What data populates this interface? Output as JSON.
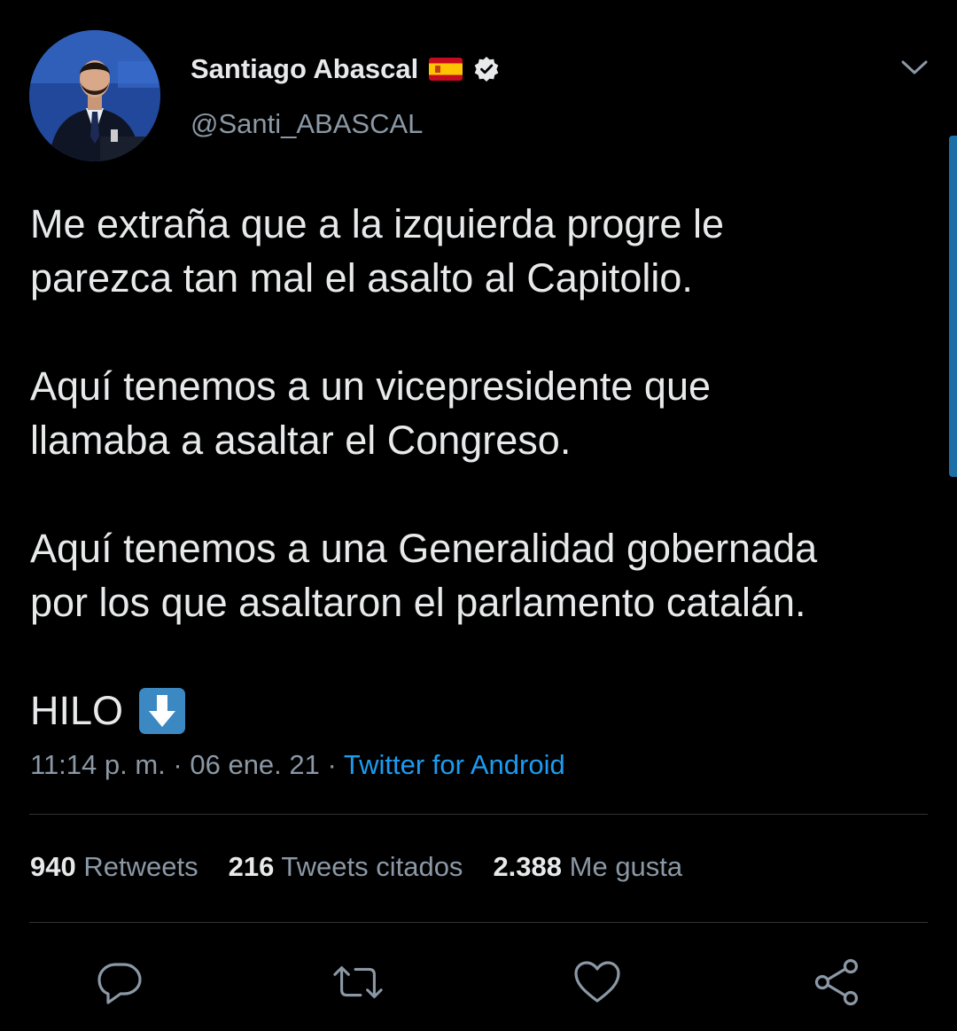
{
  "author": {
    "display_name": "Santiago Abascal",
    "handle": "@Santi_ABASCAL"
  },
  "tweet": {
    "paragraphs": [
      [
        "Me extraña que a la izquierda progre le",
        "parezca tan mal el asalto al Capitolio."
      ],
      [
        "Aquí tenemos a un vicepresidente que",
        "llamaba a asaltar el Congreso."
      ],
      [
        "Aquí tenemos a una Generalidad gobernada",
        "por los que asaltaron el parlamento catalán."
      ]
    ],
    "thread_label": "HILO"
  },
  "meta": {
    "time": "11:14 p. m.",
    "separator": " · ",
    "date": "06 ene. 21",
    "source": "Twitter for Android"
  },
  "stats": {
    "retweets_count": "940",
    "retweets_label": "Retweets",
    "quotes_count": "216",
    "quotes_label": "Tweets citados",
    "likes_count": "2.388",
    "likes_label": "Me gusta"
  },
  "icons": {
    "reply": "reply-icon",
    "retweet": "retweet-icon",
    "like": "heart-icon",
    "share": "share-icon",
    "verified": "verified-badge-icon",
    "flag": "spain-flag-icon",
    "emoji": "down-arrow-emoji",
    "menu": "chevron-down-icon"
  },
  "colors": {
    "background": "#000000",
    "text": "#e7e9ea",
    "secondary": "#8b98a5",
    "link": "#1d9bf0",
    "divider": "#2f3336"
  }
}
